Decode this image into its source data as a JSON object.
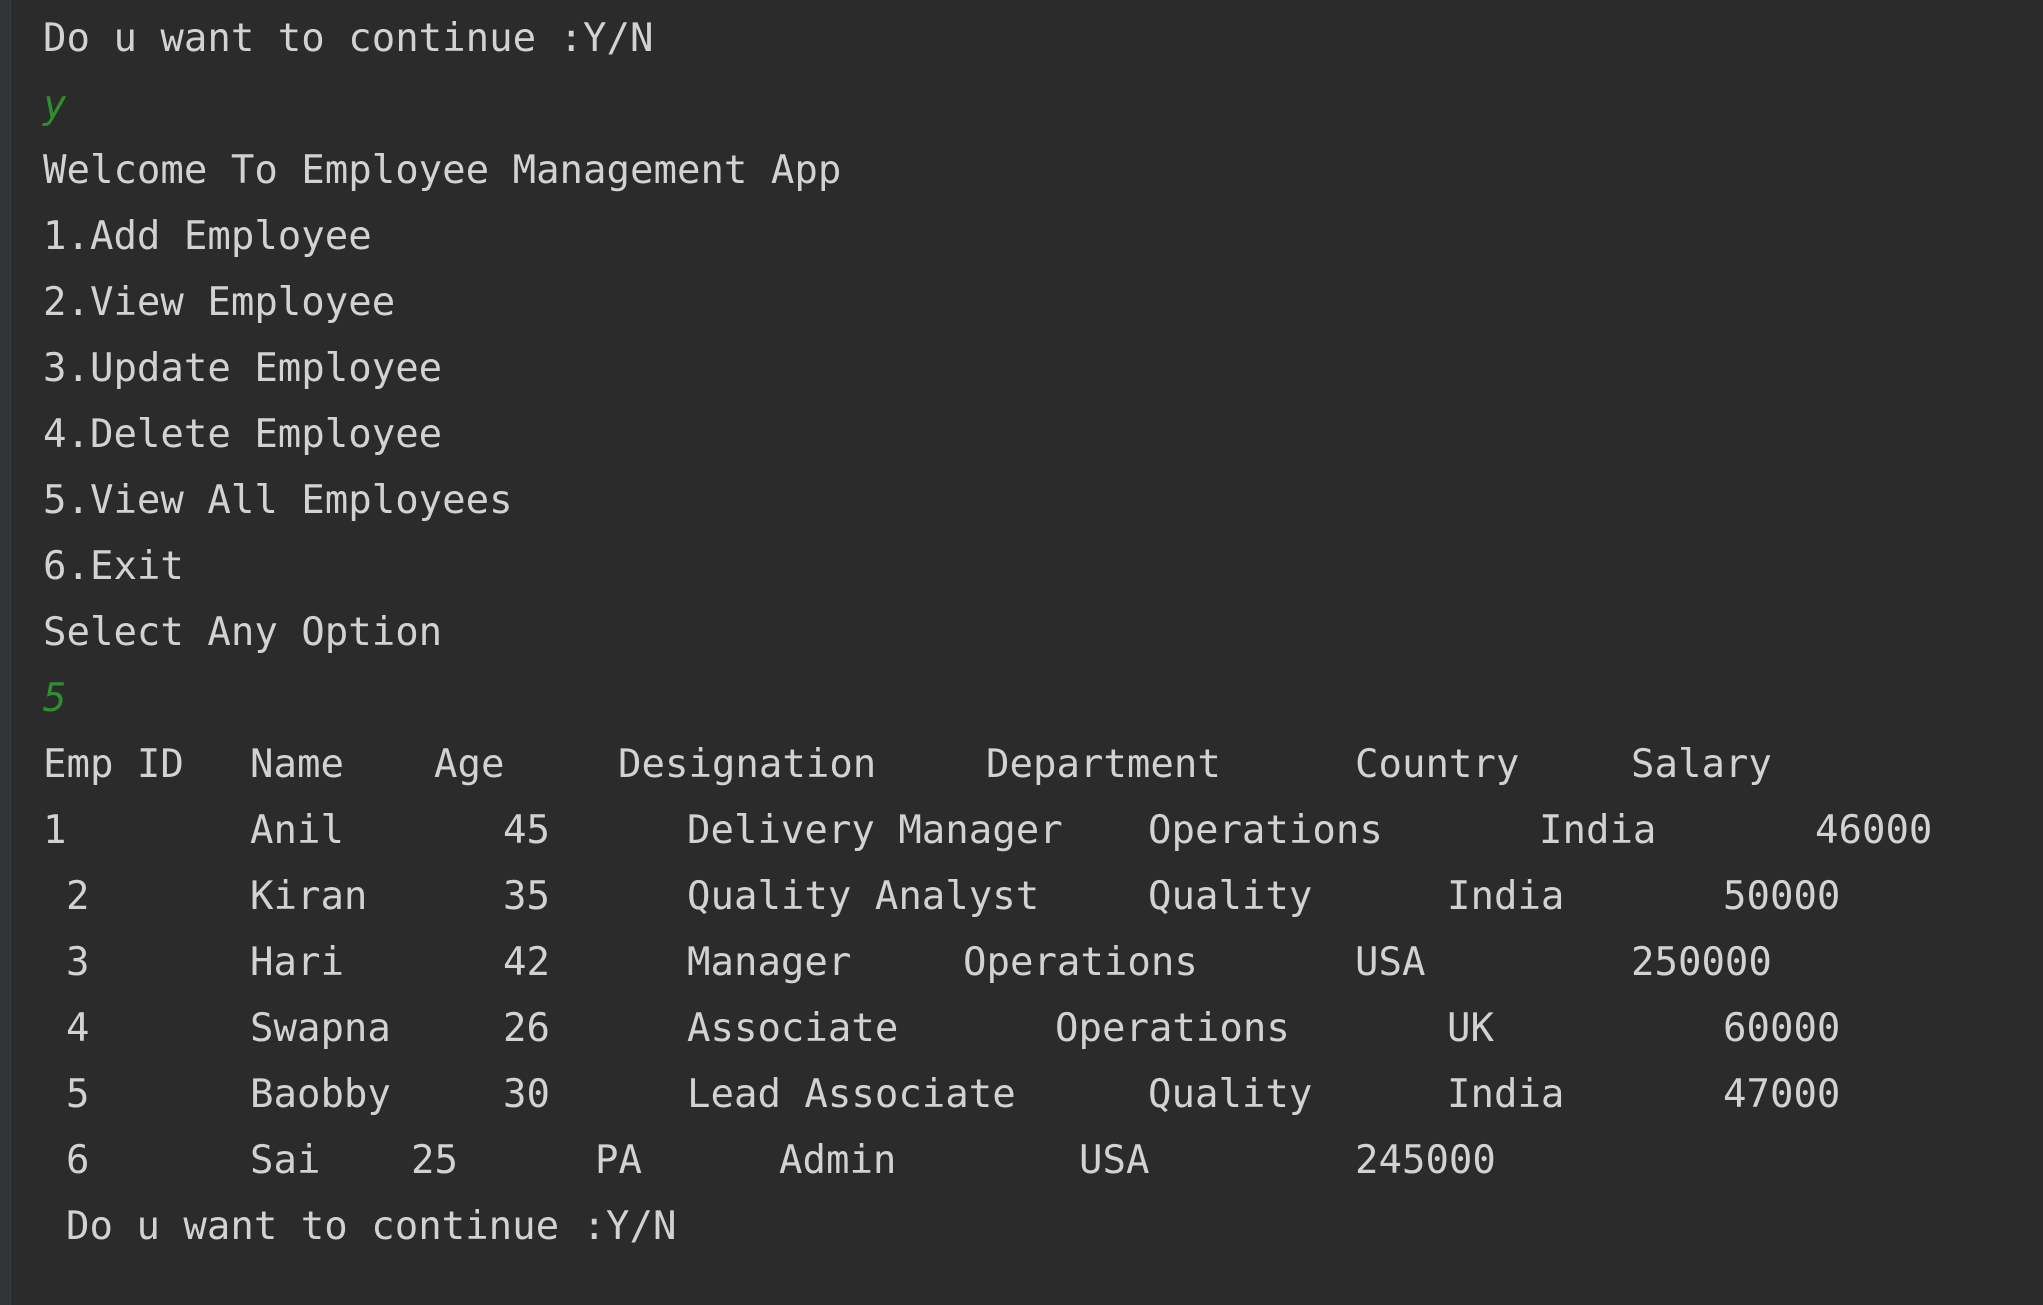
{
  "console": {
    "prompt_continue": "Do u want to continue :Y/N",
    "input_continue": "y",
    "welcome": "Welcome To Employee Management App",
    "menu": [
      "1.Add Employee",
      "2.View Employee",
      "3.Update Employee",
      "4.Delete Employee",
      "5.View All Employees",
      "6.Exit"
    ],
    "select_prompt": "Select Any Option",
    "input_option": "5",
    "table": {
      "headers": [
        "Emp ID",
        "Name",
        "Age",
        "Designation",
        "Department",
        "Country",
        "Salary"
      ],
      "rows": [
        [
          "1",
          "Anil",
          "45",
          "Delivery Manager",
          "Operations",
          "India",
          "46000"
        ],
        [
          "2",
          "Kiran",
          "35",
          "Quality Analyst",
          "Quality",
          "India",
          "50000"
        ],
        [
          "3",
          "Hari",
          "42",
          "Manager",
          "Operations",
          "USA",
          "250000"
        ],
        [
          "4",
          "Swapna",
          "26",
          "Associate",
          "Operations",
          "UK",
          "60000"
        ],
        [
          "5",
          "Baobby",
          "30",
          "Lead Associate",
          "Quality",
          "India",
          "47000"
        ],
        [
          "6",
          "Sai",
          "25",
          "PA",
          "Admin",
          "USA",
          "245000"
        ]
      ]
    },
    "prompt_continue_2": "Do u want to continue :Y/N"
  },
  "colors": {
    "background": "#2b2b2b",
    "text": "#d2d2d2",
    "user_input": "#2f8f2f"
  }
}
